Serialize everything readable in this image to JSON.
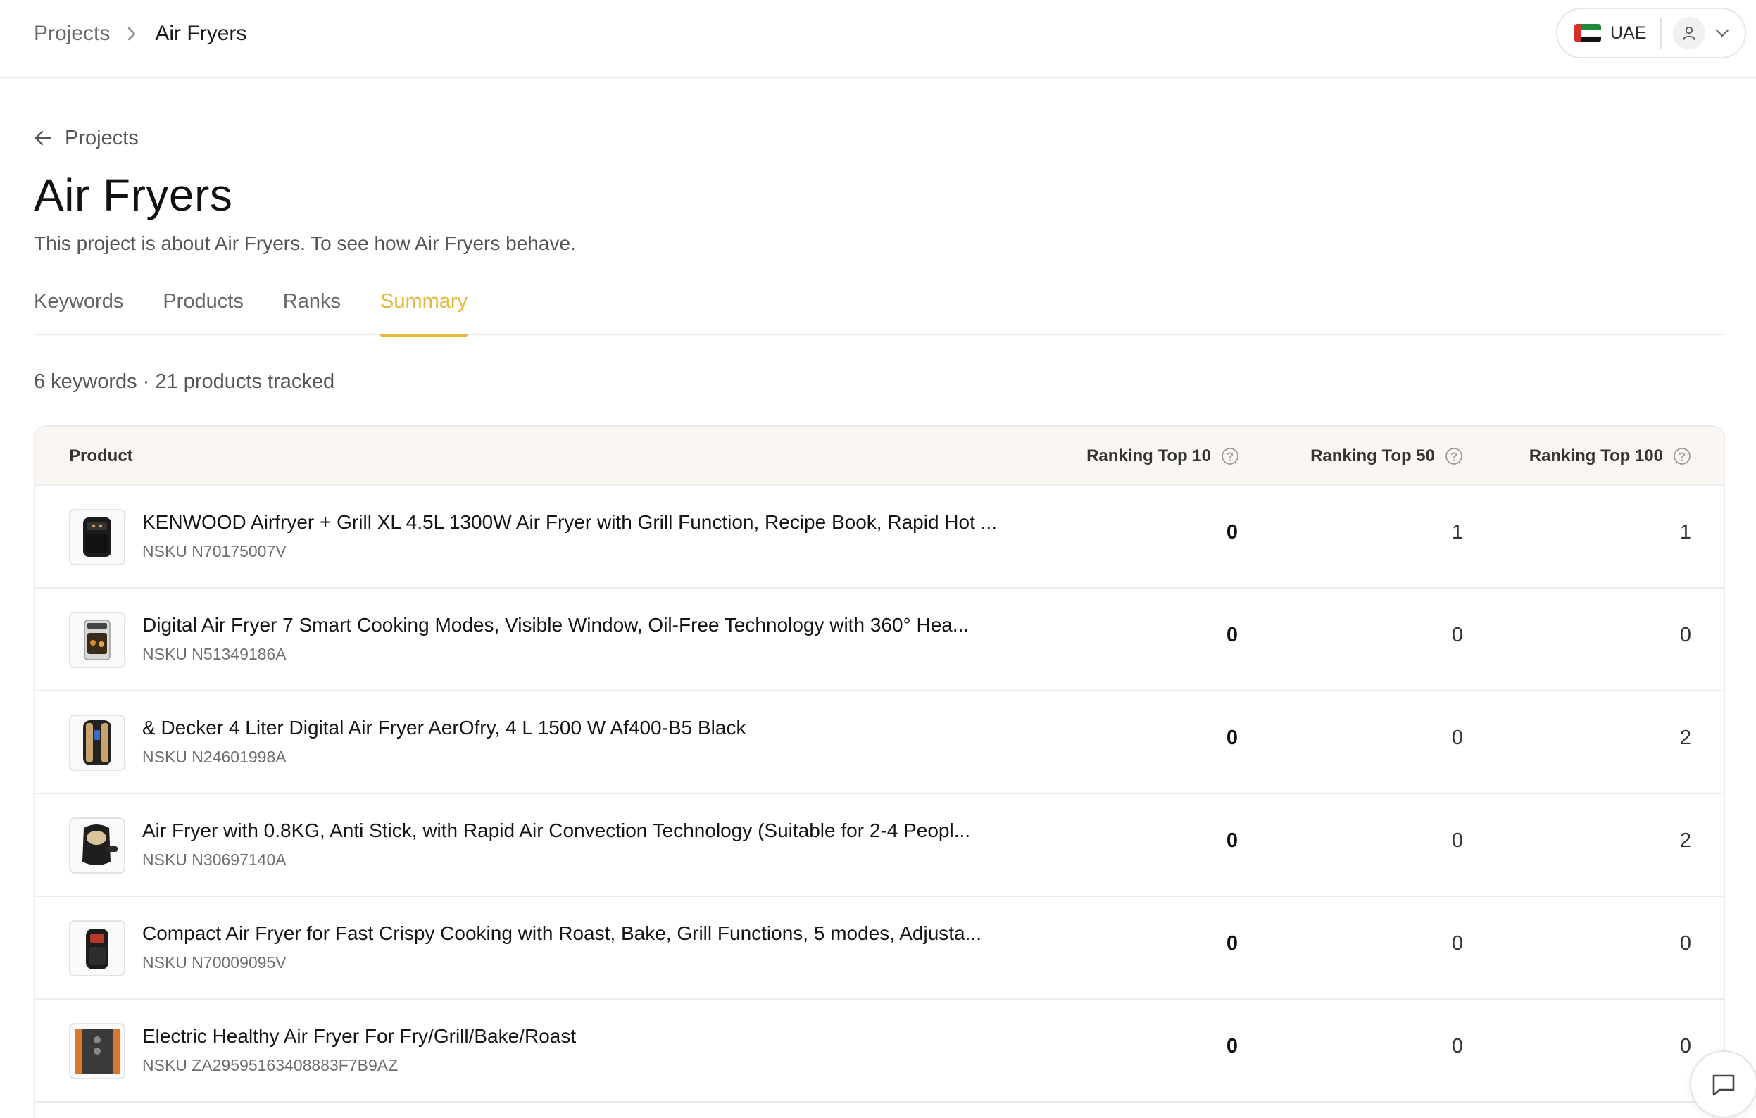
{
  "breadcrumb": {
    "parent": "Projects",
    "current": "Air Fryers"
  },
  "header": {
    "country": "UAE",
    "flag_colors": {
      "red": "#d32f2f",
      "green": "#1e8b3a",
      "white": "#ffffff",
      "black": "#111111"
    }
  },
  "back_link": {
    "label": "Projects"
  },
  "project": {
    "title": "Air Fryers",
    "description": "This project is about Air Fryers. To see how Air Fryers behave."
  },
  "tabs": [
    {
      "label": "Keywords",
      "active": false
    },
    {
      "label": "Products",
      "active": false
    },
    {
      "label": "Ranks",
      "active": false
    },
    {
      "label": "Summary",
      "active": true
    }
  ],
  "summary": {
    "counts_text": "6 keywords · 21 products tracked"
  },
  "table": {
    "columns": {
      "product": "Product",
      "top10": "Ranking Top 10",
      "top50": "Ranking Top 50",
      "top100": "Ranking Top 100"
    },
    "rows": [
      {
        "name": "KENWOOD Airfryer + Grill XL 4.5L 1300W Air Fryer with Grill Function, Recipe Book, Rapid Hot ...",
        "sku": "NSKU N70175007V",
        "top10": "0",
        "top50": "1",
        "top100": "1"
      },
      {
        "name": "Digital Air Fryer  7 Smart Cooking Modes, Visible Window, Oil-Free Technology with 360° Hea...",
        "sku": "NSKU N51349186A",
        "top10": "0",
        "top50": "0",
        "top100": "0"
      },
      {
        "name": "& Decker 4 Liter Digital Air Fryer AerOfry, 4 L 1500 W Af400-B5 Black",
        "sku": "NSKU N24601998A",
        "top10": "0",
        "top50": "0",
        "top100": "2"
      },
      {
        "name": "Air Fryer with 0.8KG, Anti Stick, with Rapid Air Convection Technology (Suitable for 2-4 Peopl...",
        "sku": "NSKU N30697140A",
        "top10": "0",
        "top50": "0",
        "top100": "2"
      },
      {
        "name": "Compact Air Fryer for Fast Crispy Cooking with Roast, Bake, Grill Functions, 5 modes, Adjusta...",
        "sku": "NSKU N70009095V",
        "top10": "0",
        "top50": "0",
        "top100": "0"
      },
      {
        "name": "Electric Healthy Air Fryer For Fry/Grill/Bake/Roast",
        "sku": "NSKU ZA29595163408883F7B9AZ",
        "top10": "0",
        "top50": "0",
        "top100": "0"
      }
    ]
  },
  "colors": {
    "accent": "#e5b73b",
    "border": "#ececec",
    "header_bg": "#faf7f3"
  }
}
